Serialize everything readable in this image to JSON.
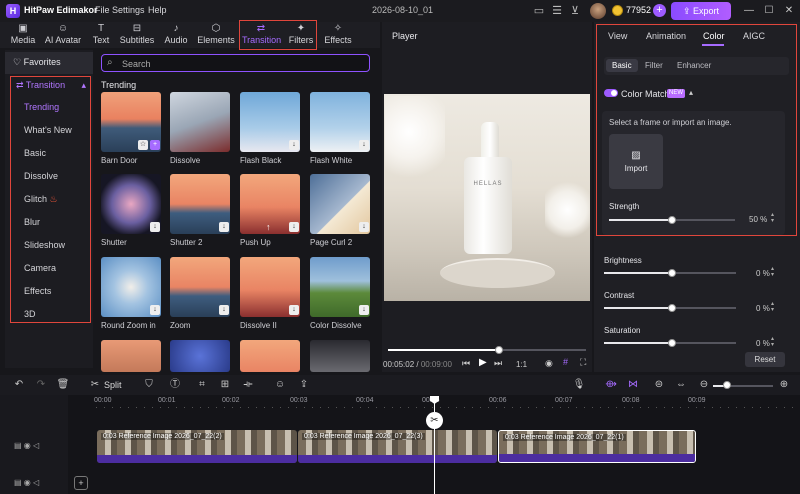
{
  "app": {
    "name": "HitPaw Edimakor",
    "menu": [
      "File",
      "Settings",
      "Help"
    ],
    "project": "2026-08-10_01",
    "credits": "77952",
    "export": "Export"
  },
  "toolbar": [
    {
      "label": "Media",
      "icon": "media-icon"
    },
    {
      "label": "AI Avatar",
      "icon": "avatar-icon"
    },
    {
      "label": "Text",
      "icon": "text-icon"
    },
    {
      "label": "Subtitles",
      "icon": "subtitles-icon"
    },
    {
      "label": "Audio",
      "icon": "music-icon"
    },
    {
      "label": "Elements",
      "icon": "elements-icon"
    },
    {
      "label": "Transition",
      "icon": "transition-icon"
    },
    {
      "label": "Filters",
      "icon": "filters-icon"
    },
    {
      "label": "Effects",
      "icon": "effects-icon"
    }
  ],
  "sidebar": {
    "favorites": "Favorites",
    "header": "Transition",
    "items": [
      "Trending",
      "What's New",
      "Basic",
      "Dissolve",
      "Glitch",
      "Blur",
      "Slideshow",
      "Camera",
      "Effects",
      "3D"
    ]
  },
  "search": {
    "placeholder": "Search"
  },
  "section": "Trending",
  "transitions": [
    "Barn Door",
    "Dissolve",
    "Flash Black",
    "Flash White",
    "Shutter",
    "Shutter 2",
    "Push Up",
    "Page Curl 2",
    "Round Zoom in",
    "Zoom",
    "Dissolve II",
    "Color Dissolve"
  ],
  "player": {
    "title": "Player",
    "current": "00:05:02",
    "total": "00:09:00",
    "speed": "1:1",
    "bottle_text": "HELLAS"
  },
  "right": {
    "tabs": [
      "View",
      "Animation",
      "Color",
      "AIGC"
    ],
    "subtabs": [
      "Basic",
      "Filter",
      "Enhancer"
    ],
    "color_match": "Color Match",
    "new": "NEW",
    "select_text": "Select a frame or import an image.",
    "import": "Import",
    "strength": "Strength",
    "strength_val": "50",
    "brightness": "Brightness",
    "brightness_val": "0",
    "contrast": "Contrast",
    "contrast_val": "0",
    "saturation": "Saturation",
    "saturation_val": "0",
    "unit": "%",
    "reset": "Reset"
  },
  "timeline": {
    "split": "Split",
    "ruler": [
      "00:00",
      "00:01",
      "00:02",
      "00:03",
      "00:04",
      "00:05",
      "00:06",
      "00:07",
      "00:08",
      "00:09"
    ],
    "clips": [
      "0:03 Reference Image 2026_07_22(2)",
      "0:03 Reference Image 2026_07_22(3)",
      "0:03 Reference Image 2026_07_22(1)"
    ]
  },
  "colors": {
    "accent": "#a66bff",
    "highlight": "#e0463c"
  }
}
